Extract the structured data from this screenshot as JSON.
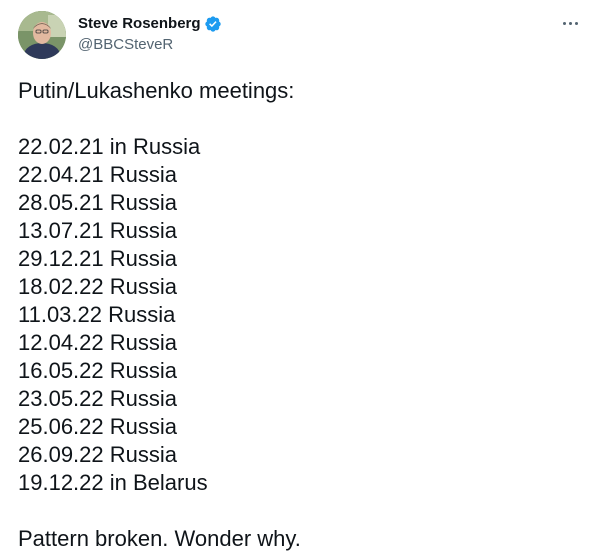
{
  "author": {
    "display_name": "Steve Rosenberg",
    "handle": "@BBCSteveR",
    "verified": true,
    "avatar_icon": "avatar-photo",
    "verified_color": "#1d9bf0"
  },
  "menu": {
    "icon": "more-horizontal-icon"
  },
  "tweet": {
    "intro": "Putin/Lukashenko meetings:",
    "meetings": [
      "22.02.21 in Russia",
      "22.04.21 Russia",
      "28.05.21 Russia",
      "13.07.21 Russia",
      "29.12.21 Russia",
      "18.02.22 Russia",
      "11.03.22 Russia",
      "12.04.22 Russia",
      "16.05.22 Russia",
      "23.05.22 Russia",
      "25.06.22 Russia",
      "26.09.22 Russia",
      "19.12.22 in Belarus"
    ],
    "closing": "Pattern broken. Wonder why."
  }
}
